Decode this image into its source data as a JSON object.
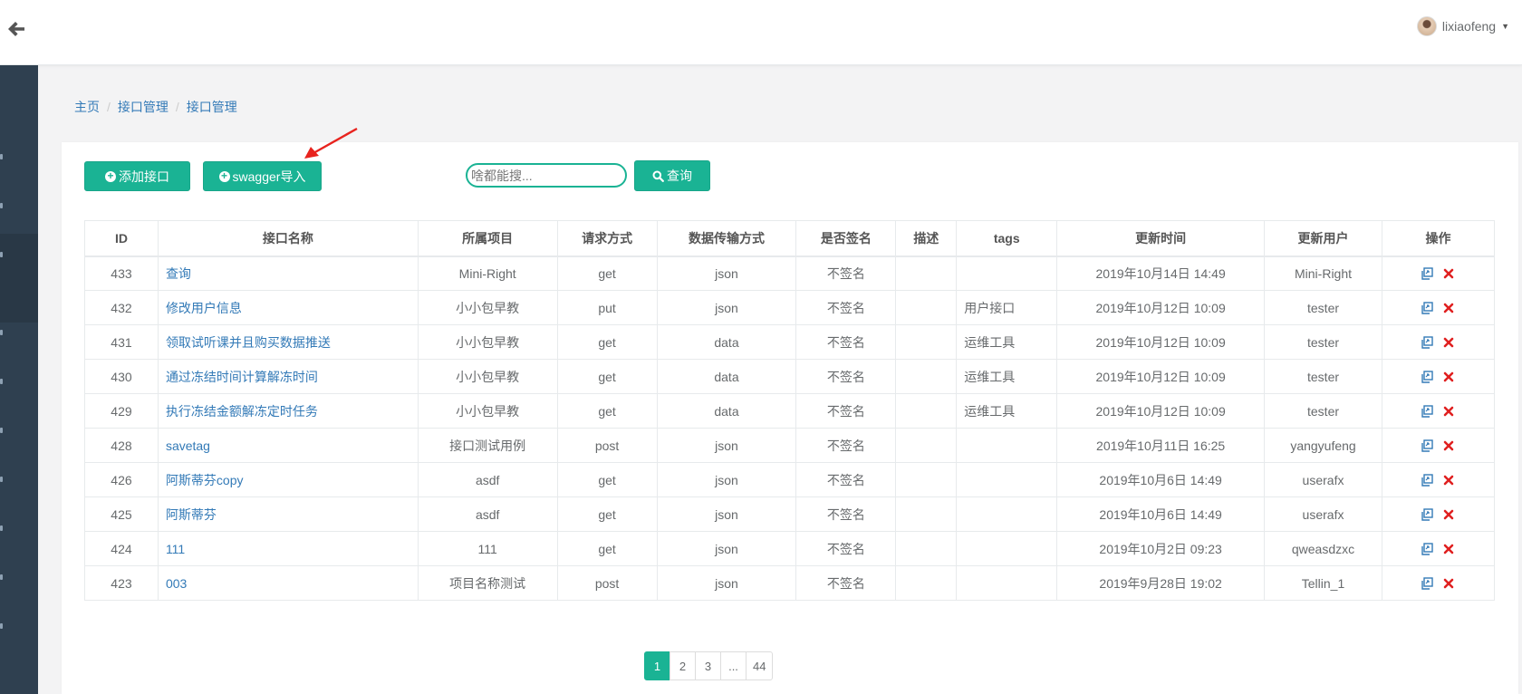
{
  "header": {
    "username": "lixiaofeng"
  },
  "breadcrumb": [
    "主页",
    "接口管理",
    "接口管理"
  ],
  "toolbar": {
    "add_label": "添加接口",
    "swagger_label": "swagger导入",
    "search_placeholder": "啥都能搜...",
    "search_label": "查询"
  },
  "table": {
    "headers": [
      "ID",
      "接口名称",
      "所属项目",
      "请求方式",
      "数据传输方式",
      "是否签名",
      "描述",
      "tags",
      "更新时间",
      "更新用户",
      "操作"
    ],
    "rows": [
      {
        "id": "433",
        "name": "查询",
        "project": "Mini-Right",
        "method": "get",
        "transfer": "json",
        "sign": "不签名",
        "desc": "",
        "tags": "",
        "updated": "2019年10月14日 14:49",
        "user": "Mini-Right"
      },
      {
        "id": "432",
        "name": "修改用户信息",
        "project": "小小包早教",
        "method": "put",
        "transfer": "json",
        "sign": "不签名",
        "desc": "",
        "tags": "用户接口",
        "updated": "2019年10月12日 10:09",
        "user": "tester"
      },
      {
        "id": "431",
        "name": "领取试听课并且购买数据推送",
        "project": "小小包早教",
        "method": "get",
        "transfer": "data",
        "sign": "不签名",
        "desc": "",
        "tags": "运维工具",
        "updated": "2019年10月12日 10:09",
        "user": "tester"
      },
      {
        "id": "430",
        "name": "通过冻结时间计算解冻时间",
        "project": "小小包早教",
        "method": "get",
        "transfer": "data",
        "sign": "不签名",
        "desc": "",
        "tags": "运维工具",
        "updated": "2019年10月12日 10:09",
        "user": "tester"
      },
      {
        "id": "429",
        "name": "执行冻结金额解冻定时任务",
        "project": "小小包早教",
        "method": "get",
        "transfer": "data",
        "sign": "不签名",
        "desc": "",
        "tags": "运维工具",
        "updated": "2019年10月12日 10:09",
        "user": "tester"
      },
      {
        "id": "428",
        "name": "savetag",
        "project": "接口测试用例",
        "method": "post",
        "transfer": "json",
        "sign": "不签名",
        "desc": "",
        "tags": "",
        "updated": "2019年10月11日 16:25",
        "user": "yangyufeng"
      },
      {
        "id": "426",
        "name": "阿斯蒂芬copy",
        "project": "asdf",
        "method": "get",
        "transfer": "json",
        "sign": "不签名",
        "desc": "",
        "tags": "",
        "updated": "2019年10月6日 14:49",
        "user": "userafx"
      },
      {
        "id": "425",
        "name": "阿斯蒂芬",
        "project": "asdf",
        "method": "get",
        "transfer": "json",
        "sign": "不签名",
        "desc": "",
        "tags": "",
        "updated": "2019年10月6日 14:49",
        "user": "userafx"
      },
      {
        "id": "424",
        "name": "111",
        "project": "111",
        "method": "get",
        "transfer": "json",
        "sign": "不签名",
        "desc": "",
        "tags": "",
        "updated": "2019年10月2日 09:23",
        "user": "qweasdzxc"
      },
      {
        "id": "423",
        "name": "003",
        "project": "项目名称测试",
        "method": "post",
        "transfer": "json",
        "sign": "不签名",
        "desc": "",
        "tags": "",
        "updated": "2019年9月28日 19:02",
        "user": "Tellin_1"
      }
    ]
  },
  "pagination": {
    "pages": [
      "1",
      "2",
      "3",
      "...",
      "44"
    ],
    "current": "1"
  },
  "icons": {
    "back": "arrow-left-icon",
    "add": "plus-circle-icon",
    "search": "search-icon",
    "copy": "copy-icon",
    "delete": "delete-x-icon"
  },
  "colors": {
    "accent": "#1ab394",
    "link": "#337ab7",
    "sidebar": "#2f4050",
    "delete": "#e02020",
    "annotation_arrow": "#e8231e"
  }
}
